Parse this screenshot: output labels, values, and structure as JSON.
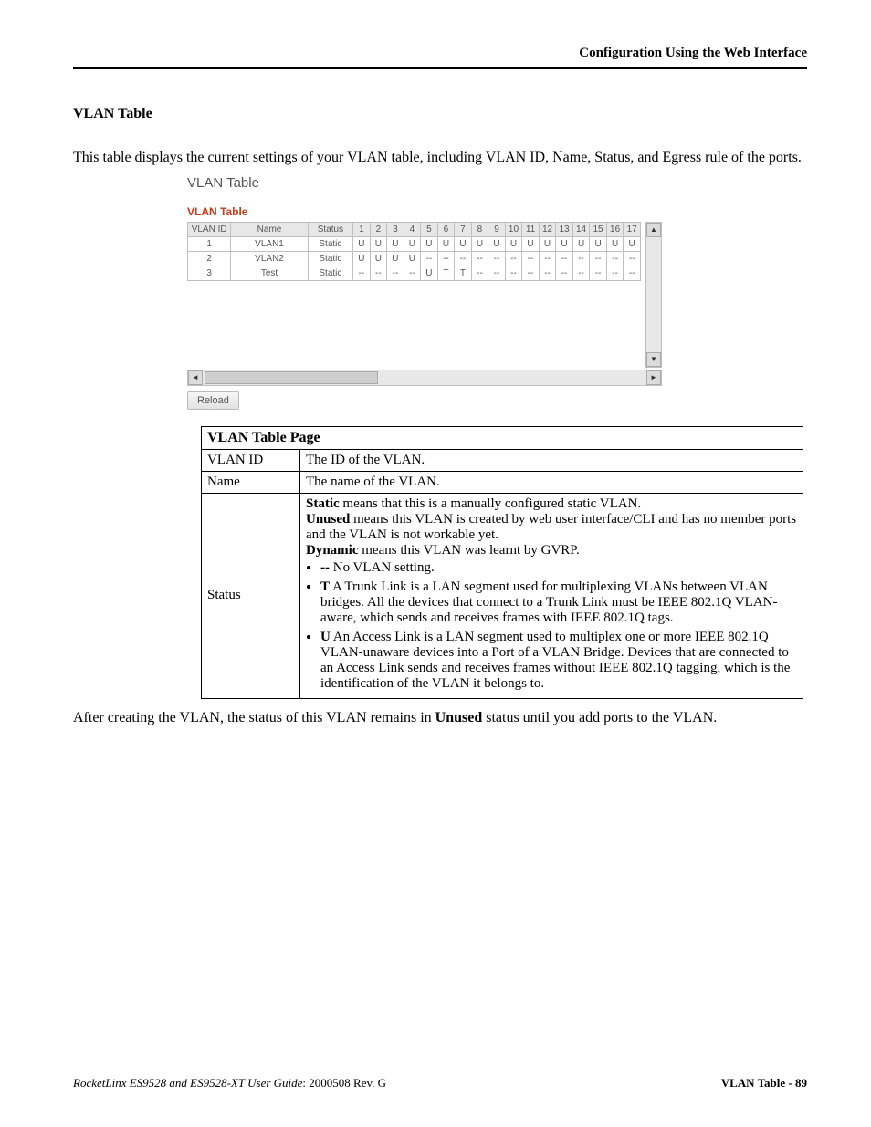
{
  "header": "Configuration Using the Web Interface",
  "section_title": "VLAN Table",
  "intro": "This table displays the current settings of your VLAN table, including VLAN ID, Name, Status, and Egress rule of the ports.",
  "screenshot": {
    "title": "VLAN Table",
    "subtitle": "VLAN Table",
    "reload": "Reload",
    "headers": {
      "vlan_id": "VLAN ID",
      "name": "Name",
      "status": "Status",
      "ports": [
        "1",
        "2",
        "3",
        "4",
        "5",
        "6",
        "7",
        "8",
        "9",
        "10",
        "11",
        "12",
        "13",
        "14",
        "15",
        "16",
        "17"
      ]
    },
    "rows": [
      {
        "id": "1",
        "name": "VLAN1",
        "status": "Static",
        "ports": [
          "U",
          "U",
          "U",
          "U",
          "U",
          "U",
          "U",
          "U",
          "U",
          "U",
          "U",
          "U",
          "U",
          "U",
          "U",
          "U",
          "U"
        ]
      },
      {
        "id": "2",
        "name": "VLAN2",
        "status": "Static",
        "ports": [
          "U",
          "U",
          "U",
          "U",
          "--",
          "--",
          "--",
          "--",
          "--",
          "--",
          "--",
          "--",
          "--",
          "--",
          "--",
          "--",
          "--"
        ]
      },
      {
        "id": "3",
        "name": "Test",
        "status": "Static",
        "ports": [
          "--",
          "--",
          "--",
          "--",
          "U",
          "T",
          "T",
          "--",
          "--",
          "--",
          "--",
          "--",
          "--",
          "--",
          "--",
          "--",
          "--"
        ]
      }
    ]
  },
  "desc_table": {
    "title": "VLAN Table Page",
    "rows": {
      "vlan_id": {
        "label": "VLAN ID",
        "text": "The ID of the VLAN."
      },
      "name": {
        "label": "Name",
        "text": "The name of the VLAN."
      },
      "status": {
        "label": "Status",
        "p1a": "Static",
        "p1b": " means that this is a manually configured static VLAN.",
        "p2a": "Unused",
        "p2b": " means this VLAN is created by web user interface/CLI and has no member ports and the VLAN is not workable yet.",
        "p3a": "Dynamic",
        "p3b": " means this VLAN was learnt by GVRP.",
        "b1a": "--",
        "b1b": "  No VLAN setting.",
        "b2a": "T",
        "b2b": "  A Trunk Link is a LAN segment used for multiplexing VLANs between VLAN bridges. All the devices that connect to a Trunk Link must be IEEE 802.1Q VLAN-aware, which sends and receives frames with IEEE 802.1Q tags.",
        "b3a": "U",
        "b3b": " An Access Link is a LAN segment used to multiplex one or more IEEE 802.1Q VLAN-unaware devices into a Port of a VLAN Bridge. Devices that are connected to an Access Link sends and receives frames without IEEE 802.1Q tagging, which is the identification of the VLAN it belongs to."
      }
    }
  },
  "after_a": "After creating the VLAN, the status of this VLAN remains in ",
  "after_b": "Unused",
  "after_c": " status until you add ports to the VLAN.",
  "footer": {
    "left_italic": "RocketLinx ES9528 and ES9528-XT User Guide",
    "left_rest": ": 2000508 Rev. G",
    "right": "VLAN Table - 89"
  }
}
